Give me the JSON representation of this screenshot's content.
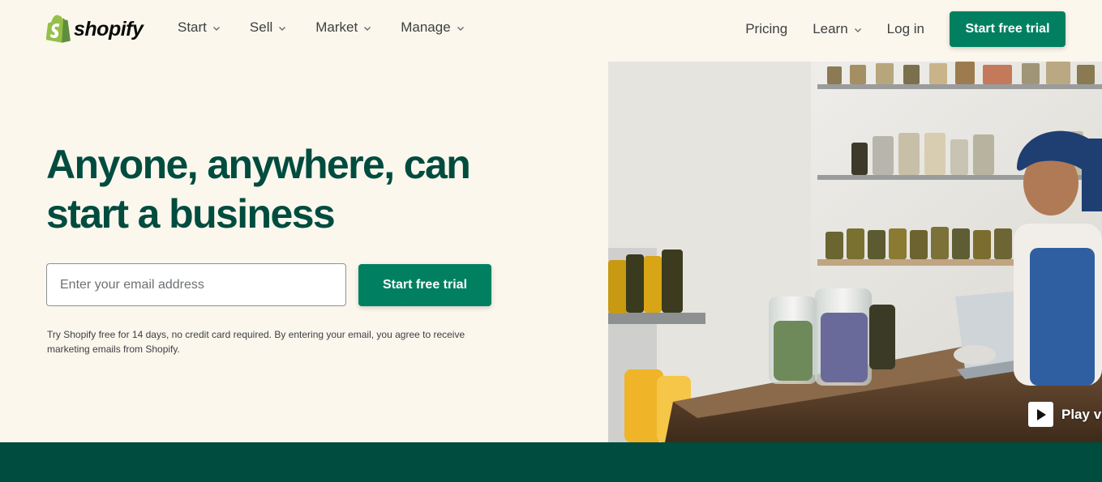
{
  "brand": {
    "name": "shopify",
    "colors": {
      "primary": "#008060",
      "heading": "#004c3f",
      "background": "#fbf7ed",
      "band": "#004c3f"
    }
  },
  "nav": {
    "left": [
      {
        "label": "Start",
        "icon": "chevron-down-icon"
      },
      {
        "label": "Sell",
        "icon": "chevron-down-icon"
      },
      {
        "label": "Market",
        "icon": "chevron-down-icon"
      },
      {
        "label": "Manage",
        "icon": "chevron-down-icon"
      }
    ],
    "pricing": "Pricing",
    "learn": "Learn",
    "login": "Log in",
    "cta": "Start free trial"
  },
  "hero": {
    "title": "Anyone, anywhere, can start a business",
    "email_placeholder": "Enter your email address",
    "cta": "Start free trial",
    "disclaimer": "Try Shopify free for 14 days, no credit card required. By entering your email, you agree to receive marketing emails from Shopify.",
    "play_video": "Play video"
  }
}
